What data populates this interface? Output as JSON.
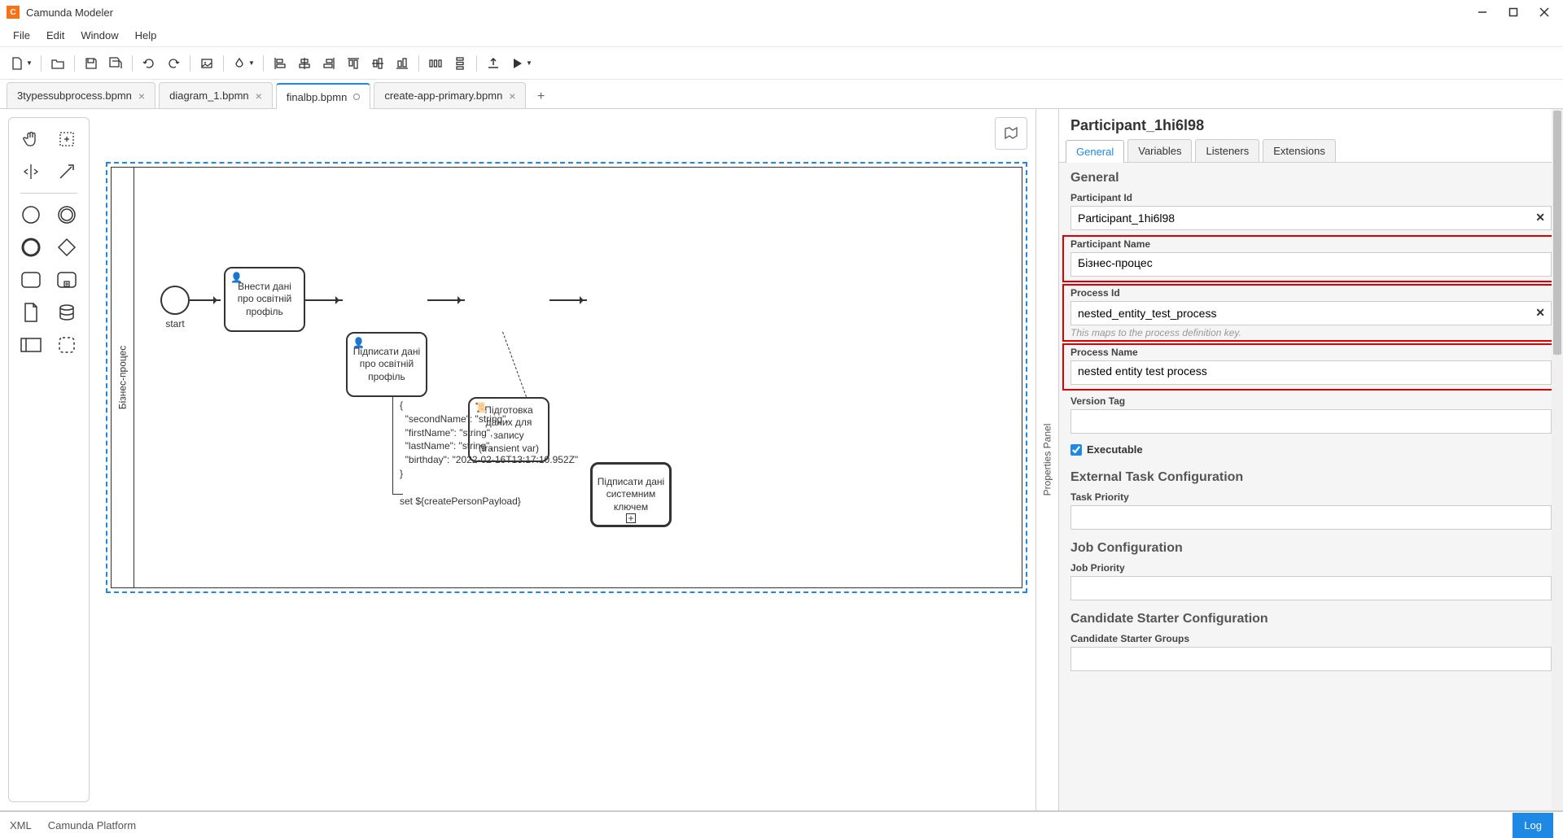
{
  "app": {
    "title": "Camunda Modeler"
  },
  "menu": {
    "file": "File",
    "edit": "Edit",
    "window": "Window",
    "help": "Help"
  },
  "tabs": {
    "t0": "3typessubprocess.bpmn",
    "t1": "diagram_1.bpmn",
    "t2": "finalbp.bpmn",
    "t3": "create-app-primary.bpmn"
  },
  "canvas": {
    "pool_label": "Бізнес-процес",
    "start_label": "start",
    "task1": "Внести дані про освітній профіль",
    "task2": "Підписати дані про освітній профіль",
    "task3": "Підготовка даних для запису (transient var)",
    "task4": "Підписати дані системним ключем",
    "annotation": "{\n  \"secondName\": \"string\",\n  \"firstName\": \"string\",\n  \"lastName\": \"string\",\n  \"birthday\": \"2022-02-16T13:17:10.952Z\"\n}\n\nset ${createPersonPayload}"
  },
  "props_panel": {
    "collapse_label": "Properties Panel",
    "title": "Participant_1hi6l98",
    "tabs": {
      "general": "General",
      "variables": "Variables",
      "listeners": "Listeners",
      "extensions": "Extensions"
    },
    "general": {
      "section": "General",
      "participant_id_label": "Participant Id",
      "participant_id": "Participant_1hi6l98",
      "participant_name_label": "Participant Name",
      "participant_name": "Бізнес-процес",
      "process_id_label": "Process Id",
      "process_id": "nested_entity_test_process",
      "process_id_hint": "This maps to the process definition key.",
      "process_name_label": "Process Name",
      "process_name": "nested entity test process",
      "version_tag_label": "Version Tag",
      "executable_label": "Executable"
    },
    "ext_task": {
      "section": "External Task Configuration",
      "task_priority_label": "Task Priority"
    },
    "job": {
      "section": "Job Configuration",
      "job_priority_label": "Job Priority"
    },
    "candidate": {
      "section": "Candidate Starter Configuration",
      "groups_label": "Candidate Starter Groups"
    }
  },
  "status": {
    "xml": "XML",
    "platform": "Camunda Platform",
    "log": "Log"
  }
}
